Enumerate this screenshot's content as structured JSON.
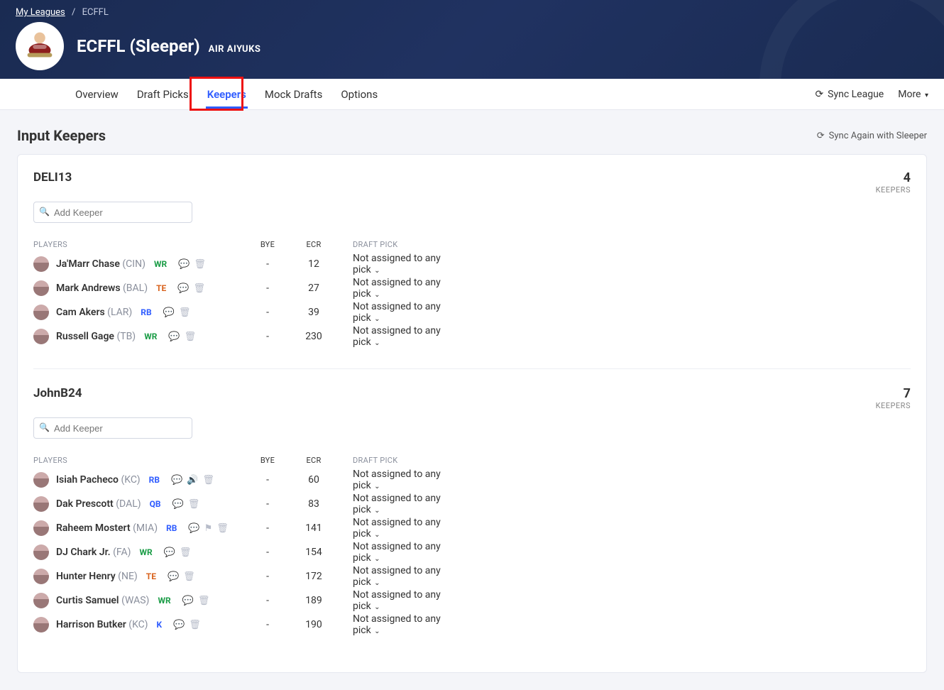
{
  "breadcrumb": {
    "root": "My Leagues",
    "current": "ECFFL"
  },
  "header": {
    "title": "ECFFL (Sleeper)",
    "subtitle": "AIR AIYUKS",
    "tabs": [
      "Overview",
      "Draft Picks",
      "Keepers",
      "Mock Drafts",
      "Options"
    ],
    "active_tab": "Keepers",
    "sync_label": "Sync League",
    "more_label": "More"
  },
  "page": {
    "title": "Input Keepers",
    "sync_again": "Sync Again with Sleeper",
    "add_placeholder": "Add Keeper",
    "columns": {
      "players": "PLAYERS",
      "bye": "BYE",
      "ecr": "ECR",
      "pick": "DRAFT PICK"
    },
    "keepers_label": "KEEPERS",
    "default_pick": "Not assigned to any pick"
  },
  "pos_colors": {
    "WR": "#1a9c46",
    "TE": "#d9631e",
    "RB": "#2f5cff",
    "QB": "#2f5cff",
    "K": "#2f5cff"
  },
  "teams": [
    {
      "owner": "DELI13",
      "count": 4,
      "players": [
        {
          "name": "Ja'Marr Chase",
          "team": "CIN",
          "pos": "WR",
          "bye": "-",
          "ecr": "12",
          "pick": "Not assigned to any pick",
          "flags": [
            "note",
            "trash"
          ]
        },
        {
          "name": "Mark Andrews",
          "team": "BAL",
          "pos": "TE",
          "bye": "-",
          "ecr": "27",
          "pick": "Not assigned to any pick",
          "flags": [
            "note",
            "trash"
          ]
        },
        {
          "name": "Cam Akers",
          "team": "LAR",
          "pos": "RB",
          "bye": "-",
          "ecr": "39",
          "pick": "Not assigned to any pick",
          "flags": [
            "note",
            "trash"
          ]
        },
        {
          "name": "Russell Gage",
          "team": "TB",
          "pos": "WR",
          "bye": "-",
          "ecr": "230",
          "pick": "Not assigned to any pick",
          "flags": [
            "note",
            "trash"
          ]
        }
      ]
    },
    {
      "owner": "JohnB24",
      "count": 7,
      "players": [
        {
          "name": "Isiah Pacheco",
          "team": "KC",
          "pos": "RB",
          "bye": "-",
          "ecr": "60",
          "pick": "Not assigned to any pick",
          "flags": [
            "note",
            "sound",
            "trash"
          ]
        },
        {
          "name": "Dak Prescott",
          "team": "DAL",
          "pos": "QB",
          "bye": "-",
          "ecr": "83",
          "pick": "Not assigned to any pick",
          "flags": [
            "note",
            "trash"
          ]
        },
        {
          "name": "Raheem Mostert",
          "team": "MIA",
          "pos": "RB",
          "bye": "-",
          "ecr": "141",
          "pick": "Not assigned to any pick",
          "flags": [
            "note",
            "flag",
            "trash"
          ]
        },
        {
          "name": "DJ Chark Jr.",
          "team": "FA",
          "pos": "WR",
          "bye": "-",
          "ecr": "154",
          "pick": "Not assigned to any pick",
          "flags": [
            "note",
            "trash"
          ]
        },
        {
          "name": "Hunter Henry",
          "team": "NE",
          "pos": "TE",
          "bye": "-",
          "ecr": "172",
          "pick": "Not assigned to any pick",
          "flags": [
            "note",
            "trash"
          ]
        },
        {
          "name": "Curtis Samuel",
          "team": "WAS",
          "pos": "WR",
          "bye": "-",
          "ecr": "189",
          "pick": "Not assigned to any pick",
          "flags": [
            "note",
            "trash"
          ]
        },
        {
          "name": "Harrison Butker",
          "team": "KC",
          "pos": "K",
          "bye": "-",
          "ecr": "190",
          "pick": "Not assigned to any pick",
          "flags": [
            "note",
            "trash"
          ]
        }
      ]
    }
  ]
}
